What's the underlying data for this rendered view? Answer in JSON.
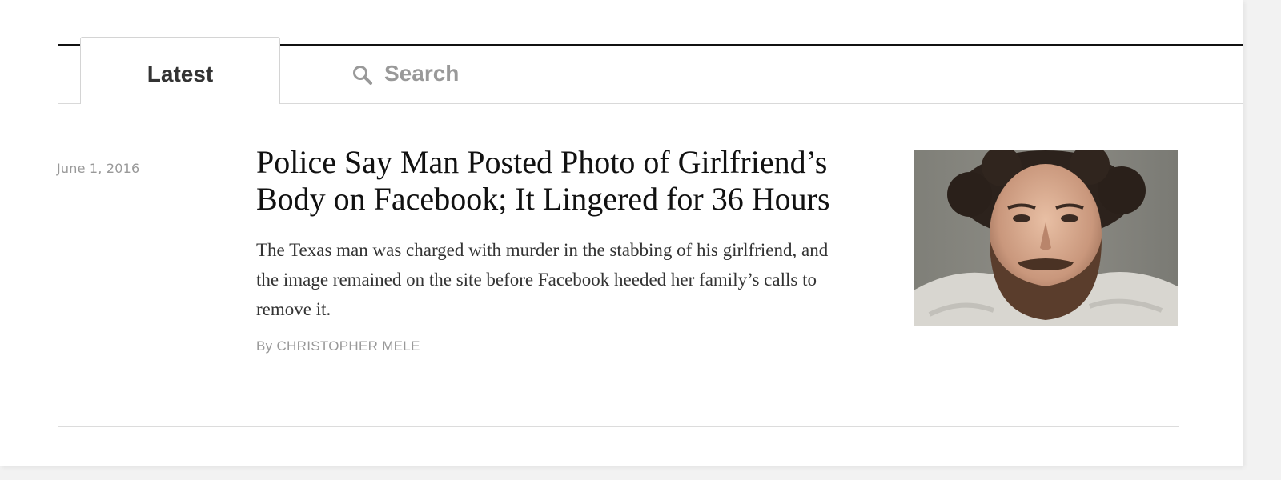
{
  "tabs": {
    "latest_label": "Latest",
    "search_label": "Search"
  },
  "article": {
    "date": "June 1, 2016",
    "headline": "Police Say Man Posted Photo of Girlfriend’s Body on Facebook; It Lingered for 36 Hours",
    "summary": "The Texas man was charged with murder in the stabbing of his girlfriend, and the image remained on the site before Facebook heeded her family’s calls to remove it.",
    "byline": "By CHRISTOPHER MELE",
    "thumbnail_icon": "mugshot-photo"
  },
  "colors": {
    "rule_dark": "#111111",
    "rule_light": "#d9d9d9",
    "muted_text": "#999999",
    "headline_text": "#111111"
  }
}
